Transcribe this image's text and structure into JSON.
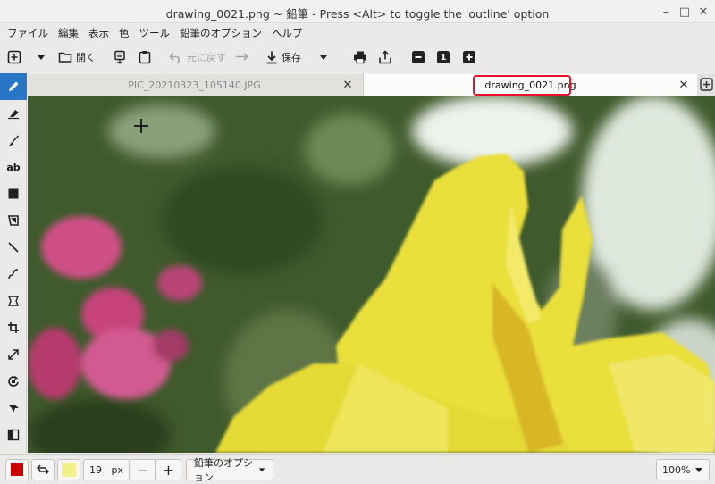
{
  "window": {
    "title": "drawing_0021.png ~ 鉛筆 - Press <Alt> to toggle the 'outline' option",
    "minimize_glyph": "–",
    "maximize_glyph": "□",
    "close_glyph": "✕"
  },
  "menu": [
    "ファイル",
    "編集",
    "表示",
    "色",
    "ツール",
    "鉛筆のオプション",
    "ヘルプ"
  ],
  "toolbar": {
    "open_label": "開く",
    "undo_label": "元に戻す",
    "save_label": "保存",
    "zoom_one_label": "1"
  },
  "tools": [
    {
      "name": "pencil",
      "icon": "pencil-icon"
    },
    {
      "name": "eraser",
      "icon": "eraser-icon"
    },
    {
      "name": "brush",
      "icon": "brush-icon"
    },
    {
      "name": "text",
      "icon": "text-icon",
      "label": "ab"
    },
    {
      "name": "rectangle",
      "icon": "rectangle-icon"
    },
    {
      "name": "free-shape",
      "icon": "free-shape-icon"
    },
    {
      "name": "line",
      "icon": "line-icon"
    },
    {
      "name": "curve",
      "icon": "curve-icon"
    },
    {
      "name": "selection",
      "icon": "selection-icon"
    },
    {
      "name": "crop",
      "icon": "crop-icon"
    },
    {
      "name": "scale",
      "icon": "scale-icon"
    },
    {
      "name": "rotate",
      "icon": "rotate-icon"
    },
    {
      "name": "skew",
      "icon": "skew-icon"
    },
    {
      "name": "filters",
      "icon": "filters-icon"
    }
  ],
  "tabs": [
    {
      "label": "PIC_20210323_105140.JPG",
      "active": false
    },
    {
      "label": "drawing_0021.png",
      "active": true
    }
  ],
  "bottom": {
    "primary_color": "#cc0000",
    "secondary_color": "#f2f08a",
    "size_value": "19",
    "size_unit": "px",
    "minus_label": "—",
    "plus_label": "+",
    "options_label": "鉛筆のオプション",
    "zoom_label": "100%"
  },
  "colors": {
    "accent": "#2a76c6",
    "highlight_border": "#e8102a"
  }
}
